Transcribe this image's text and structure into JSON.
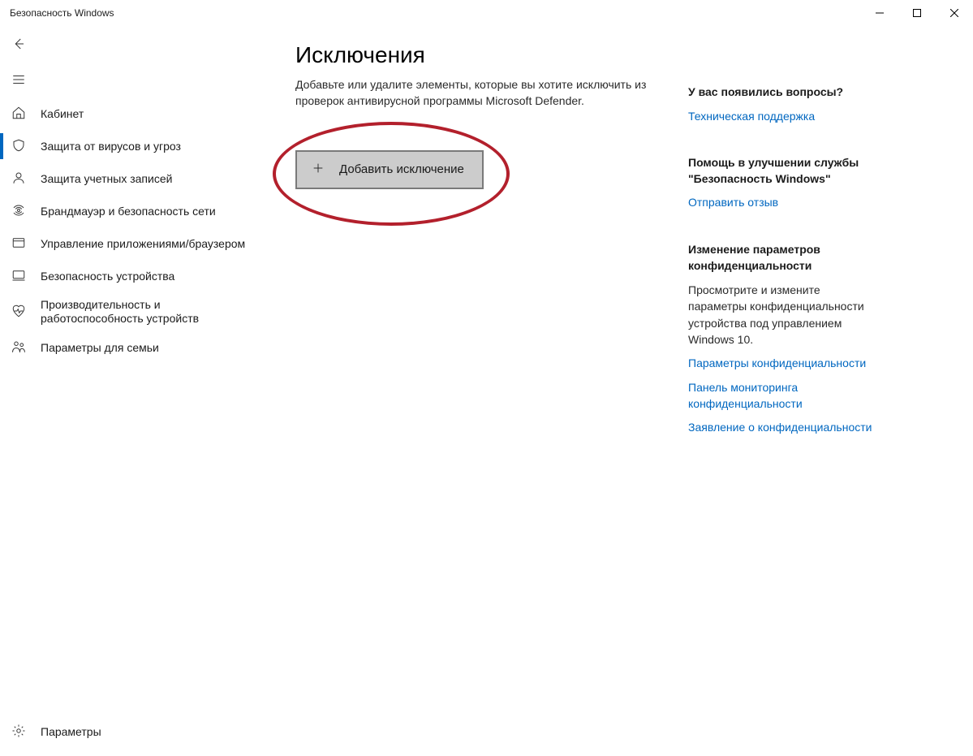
{
  "window": {
    "title": "Безопасность Windows"
  },
  "sidebar": {
    "items": [
      {
        "label": "Кабинет"
      },
      {
        "label": "Защита от вирусов и угроз"
      },
      {
        "label": "Защита учетных записей"
      },
      {
        "label": "Брандмауэр и безопасность сети"
      },
      {
        "label": "Управление приложениями/браузером"
      },
      {
        "label": "Безопасность устройства"
      },
      {
        "label": "Производительность и работоспособность устройств"
      },
      {
        "label": "Параметры для семьи"
      }
    ],
    "footer": {
      "label": "Параметры"
    }
  },
  "main": {
    "title": "Исключения",
    "description": "Добавьте или удалите элементы, которые вы хотите исключить из проверок антивирусной программы Microsoft Defender.",
    "add_button": "Добавить исключение"
  },
  "aside": {
    "questions": {
      "heading": "У вас появились вопросы?",
      "link": "Техническая поддержка"
    },
    "feedback": {
      "heading": "Помощь в улучшении службы \"Безопасность Windows\"",
      "link": "Отправить отзыв"
    },
    "privacy": {
      "heading": "Изменение параметров конфиденциальности",
      "text": "Просмотрите и измените параметры конфиденциальности устройства под управлением Windows 10.",
      "link1": "Параметры конфиденциальности",
      "link2": "Панель мониторинга конфиденциальности",
      "link3": "Заявление о конфиденциальности"
    }
  }
}
